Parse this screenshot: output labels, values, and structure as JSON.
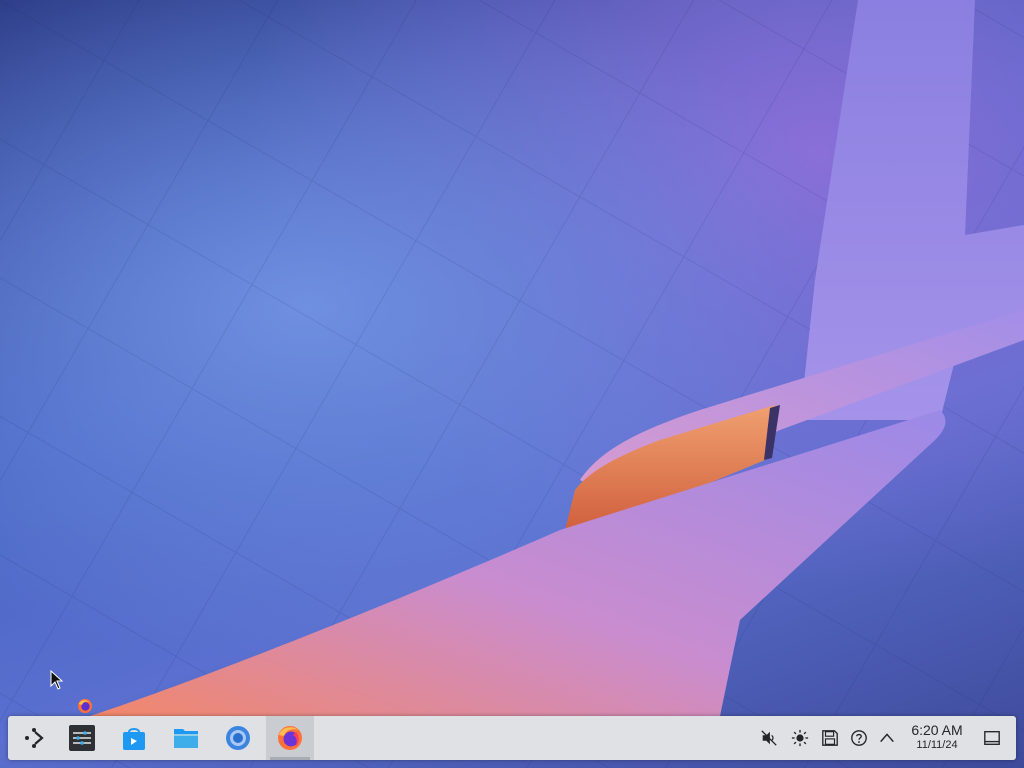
{
  "taskbar": {
    "launcher": {
      "icon": "application-launcher-icon"
    },
    "apps": [
      {
        "icon": "system-monitor-icon"
      },
      {
        "icon": "discover-store-icon"
      },
      {
        "icon": "file-manager-icon"
      },
      {
        "icon": "chromium-icon"
      },
      {
        "icon": "firefox-icon",
        "active": true
      }
    ],
    "tray": [
      {
        "icon": "volume-muted-icon"
      },
      {
        "icon": "brightness-icon"
      },
      {
        "icon": "disks-icon"
      },
      {
        "icon": "help-icon"
      },
      {
        "icon": "chevron-up-icon"
      }
    ],
    "clock": {
      "time": "6:20 AM",
      "date": "11/11/24"
    },
    "show_desktop": {
      "icon": "show-desktop-icon"
    }
  },
  "desktop": {
    "icons": [
      {
        "icon": "firefox-icon"
      }
    ]
  },
  "colors": {
    "taskbar_bg": "#dfe1e4",
    "wallpaper_base": "#4866c4",
    "ribbon_orange": "#f0966a",
    "ribbon_violet": "#9a86e6"
  }
}
